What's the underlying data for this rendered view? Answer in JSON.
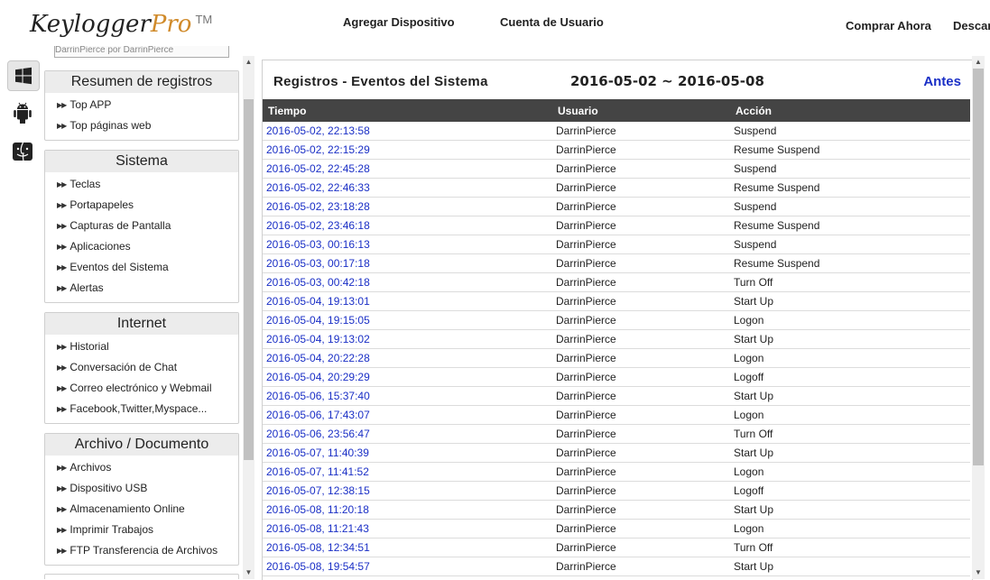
{
  "header": {
    "logo_main": "Keylogger",
    "logo_pro": "Pro",
    "logo_tm": "TM",
    "nav": {
      "add_device": "Agregar Dispositivo",
      "user_account": "Cuenta de Usuario",
      "buy_now": "Comprar Ahora",
      "download": "Descar"
    }
  },
  "os_icons": [
    "windows-icon",
    "android-icon",
    "mac-icon"
  ],
  "sidebar": {
    "top_input_text": "DarrinPierce por DarrinPierce",
    "sections": [
      {
        "title": "Resumen de registros",
        "items": [
          "Top APP",
          "Top páginas web"
        ]
      },
      {
        "title": "Sistema",
        "items": [
          "Teclas",
          "Portapapeles",
          "Capturas de Pantalla",
          "Aplicaciones",
          "Eventos del Sistema",
          "Alertas"
        ]
      },
      {
        "title": "Internet",
        "items": [
          "Historial",
          "Conversación de Chat",
          "Correo electrónico y Webmail",
          "Facebook,Twitter,Myspace..."
        ]
      },
      {
        "title": "Archivo / Documento",
        "items": [
          "Archivos",
          "Dispositivo USB",
          "Almacenamiento Online",
          "Imprimir Trabajos",
          "FTP Transferencia de Archivos"
        ]
      }
    ]
  },
  "panel": {
    "title": "Registros - Eventos del Sistema",
    "date_range": "2016-05-02 ~ 2016-05-08",
    "prev_link": "Antes",
    "columns": [
      "Tiempo",
      "Usuario",
      "Acción"
    ],
    "rows": [
      [
        "2016-05-02, 22:13:58",
        "DarrinPierce",
        "Suspend"
      ],
      [
        "2016-05-02, 22:15:29",
        "DarrinPierce",
        "Resume Suspend"
      ],
      [
        "2016-05-02, 22:45:28",
        "DarrinPierce",
        "Suspend"
      ],
      [
        "2016-05-02, 22:46:33",
        "DarrinPierce",
        "Resume Suspend"
      ],
      [
        "2016-05-02, 23:18:28",
        "DarrinPierce",
        "Suspend"
      ],
      [
        "2016-05-02, 23:46:18",
        "DarrinPierce",
        "Resume Suspend"
      ],
      [
        "2016-05-03, 00:16:13",
        "DarrinPierce",
        "Suspend"
      ],
      [
        "2016-05-03, 00:17:18",
        "DarrinPierce",
        "Resume Suspend"
      ],
      [
        "2016-05-03, 00:42:18",
        "DarrinPierce",
        "Turn Off"
      ],
      [
        "2016-05-04, 19:13:01",
        "DarrinPierce",
        "Start Up"
      ],
      [
        "2016-05-04, 19:15:05",
        "DarrinPierce",
        "Logon"
      ],
      [
        "2016-05-04, 19:13:02",
        "DarrinPierce",
        "Start Up"
      ],
      [
        "2016-05-04, 20:22:28",
        "DarrinPierce",
        "Logon"
      ],
      [
        "2016-05-04, 20:29:29",
        "DarrinPierce",
        "Logoff"
      ],
      [
        "2016-05-06, 15:37:40",
        "DarrinPierce",
        "Start Up"
      ],
      [
        "2016-05-06, 17:43:07",
        "DarrinPierce",
        "Logon"
      ],
      [
        "2016-05-06, 23:56:47",
        "DarrinPierce",
        "Turn Off"
      ],
      [
        "2016-05-07, 11:40:39",
        "DarrinPierce",
        "Start Up"
      ],
      [
        "2016-05-07, 11:41:52",
        "DarrinPierce",
        "Logon"
      ],
      [
        "2016-05-07, 12:38:15",
        "DarrinPierce",
        "Logoff"
      ],
      [
        "2016-05-08, 11:20:18",
        "DarrinPierce",
        "Start Up"
      ],
      [
        "2016-05-08, 11:21:43",
        "DarrinPierce",
        "Logon"
      ],
      [
        "2016-05-08, 12:34:51",
        "DarrinPierce",
        "Turn Off"
      ],
      [
        "2016-05-08, 19:54:57",
        "DarrinPierce",
        "Start Up"
      ]
    ]
  },
  "colors": {
    "accent_link": "#1a2fc6",
    "logo_pro": "#d08a2a",
    "table_header_bg": "#444444"
  }
}
